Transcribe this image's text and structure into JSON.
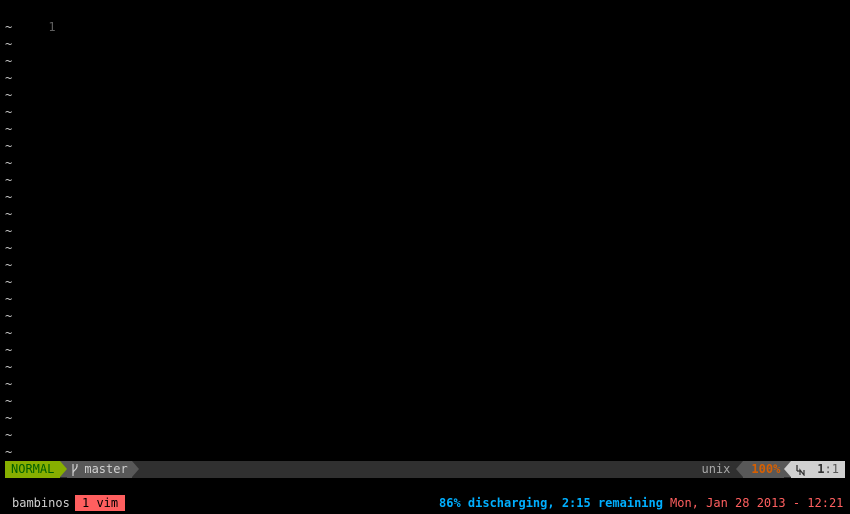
{
  "editor": {
    "first_line_number": "1",
    "empty_line_marker": "~",
    "empty_line_count": 26
  },
  "statusline": {
    "mode": "NORMAL",
    "branch": "master",
    "fileformat": "unix",
    "percent": "100%",
    "line": "1",
    "separator": ":",
    "column": "1",
    "icons": {
      "branch": "git-branch-icon",
      "line_number": "line-number-icon"
    },
    "colors": {
      "mode_bg": "#87af00",
      "mode_fg": "#005f00",
      "bar_bg": "#303030",
      "segment_bg": "#585858",
      "percent_fg": "#d75f00",
      "position_bg": "#d0d0d0"
    }
  },
  "tmux": {
    "session": "bambinos",
    "window": "1 vim",
    "battery": "86% discharging, 2:15 remaining",
    "clock": "Mon, Jan 28 2013 - 12:21",
    "colors": {
      "window_bg": "#ff5f5f",
      "battery_fg": "#00afff",
      "clock_fg": "#ff5f5f"
    }
  }
}
